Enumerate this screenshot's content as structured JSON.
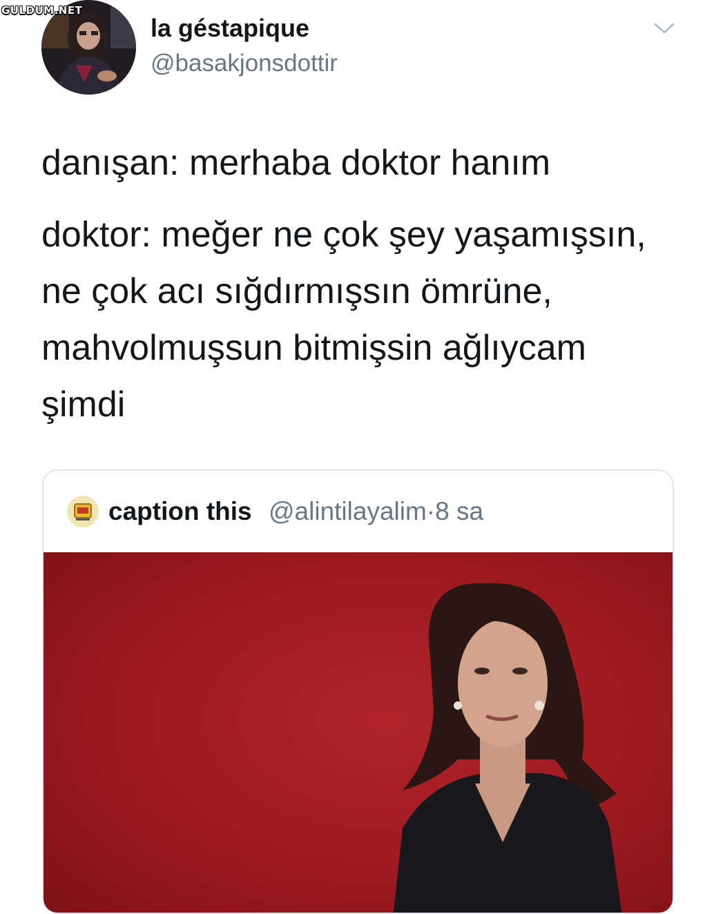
{
  "watermark": "GULDUM.NET",
  "tweet": {
    "author_name": "la géstapique",
    "author_handle": "@basakjonsdottir",
    "menu_icon": "chevron-down-icon",
    "text_line1": "danışan: merhaba doktor hanım",
    "text_para2": "doktor: meğer ne çok şey yaşamışsın,\nne çok acı sığdırmışsın ömrüne,\nmahvolmuşsun bitmişsin ağlıycam\nşimdi"
  },
  "quoted_tweet": {
    "author_name": "caption this",
    "author_handle": "@alintilayalim",
    "separator": "·",
    "time": "8 sa",
    "image_background_color": "#a51d23"
  },
  "colors": {
    "text_primary": "#14171a",
    "text_secondary": "#657786",
    "card_border": "#e1e8ed"
  }
}
